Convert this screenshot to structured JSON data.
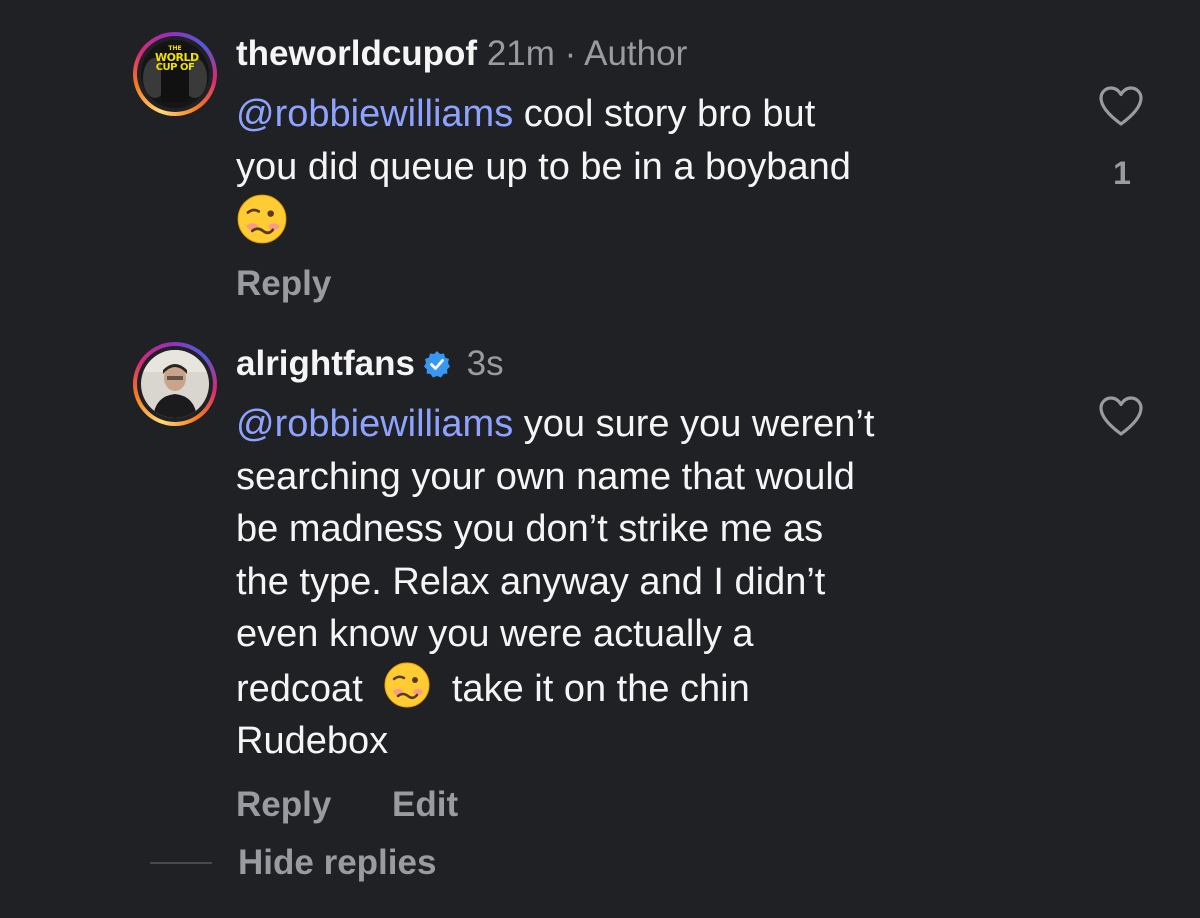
{
  "comments": [
    {
      "username": "theworldcupof",
      "time": "21m",
      "separator": "·",
      "author_tag": "Author",
      "avatar_text": [
        "THE",
        "WORLD",
        "CUP OF"
      ],
      "mention": "@robbiewilliams",
      "text_lines": [
        " cool story bro but",
        "you did queue up to be in a boyband"
      ],
      "emoji": "woozy-face",
      "reply_label": "Reply",
      "like_count": "1"
    },
    {
      "username": "alrightfans",
      "time": "3s",
      "verified": true,
      "mention": "@robbiewilliams",
      "text_lines": [
        " you sure you weren’t",
        "searching your own name that would",
        "be madness you don’t strike me as",
        "the type. Relax anyway and I didn’t",
        "even know you were actually a"
      ],
      "line6_before": "redcoat",
      "line6_after": "take it on the chin",
      "line7": "Rudebox",
      "emoji": "woozy-face",
      "reply_label": "Reply",
      "edit_label": "Edit"
    }
  ],
  "hide_replies_label": "Hide replies",
  "colors": {
    "background": "#202125",
    "mention": "#8ea3ff",
    "muted": "#9a9ba1",
    "verified": "#3897f0"
  }
}
